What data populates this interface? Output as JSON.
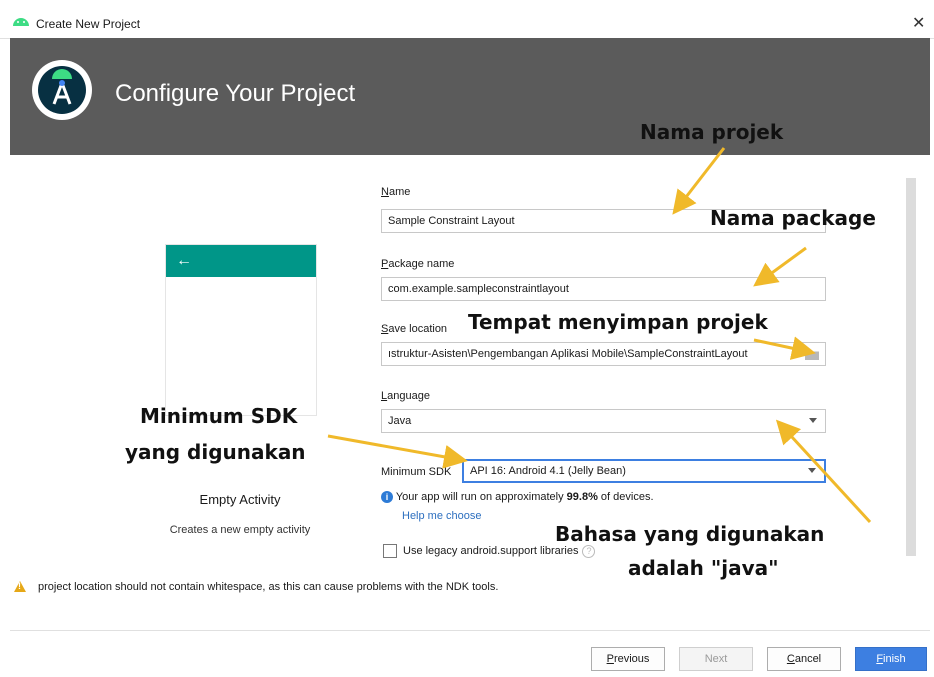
{
  "window": {
    "title": "Create New Project"
  },
  "header": {
    "title": "Configure Your Project"
  },
  "preview": {
    "back_glyph": "←",
    "name": "Empty Activity",
    "description": "Creates a new empty activity"
  },
  "form": {
    "name": {
      "label_first": "N",
      "label_rest": "ame",
      "value": "Sample Constraint Layout"
    },
    "package": {
      "label_first": "P",
      "label_rest": "ackage name",
      "value": "com.example.sampleconstraintlayout"
    },
    "save_location": {
      "label_first": "S",
      "label_rest": "ave location",
      "value": "ıstruktur-Asisten\\Pengembangan Aplikasi Mobile\\SampleConstraintLayout"
    },
    "language": {
      "label_first": "L",
      "label_rest": "anguage",
      "value": "Java"
    },
    "min_sdk": {
      "label": "Minimum SDK",
      "value": "API 16: Android 4.1 (Jelly Bean)"
    },
    "info": {
      "prefix": "Your app will run on approximately ",
      "percent": "99.8%",
      "suffix": " of devices."
    },
    "help_link": "Help me choose",
    "legacy_label": "Use legacy android.support libraries"
  },
  "warning": "project location should not contain whitespace, as this can cause problems with the NDK tools.",
  "buttons": {
    "previous": {
      "first": "P",
      "rest": "revious"
    },
    "next": "Next",
    "cancel": {
      "first": "C",
      "rest": "ancel"
    },
    "finish": {
      "first": "F",
      "rest": "inish"
    }
  },
  "annotations": {
    "name": "Nama projek",
    "package": "Nama package",
    "location": "Tempat menyimpan projek",
    "sdk_line1": "Minimum SDK",
    "sdk_line2": "yang digunakan",
    "lang_line1": "Bahasa yang digunakan",
    "lang_line2": "adalah \"java\""
  },
  "colors": {
    "header": "#5b5b5b",
    "accent": "#3d7fe1",
    "appbar": "#009688",
    "arrow": "#f0b92a"
  }
}
